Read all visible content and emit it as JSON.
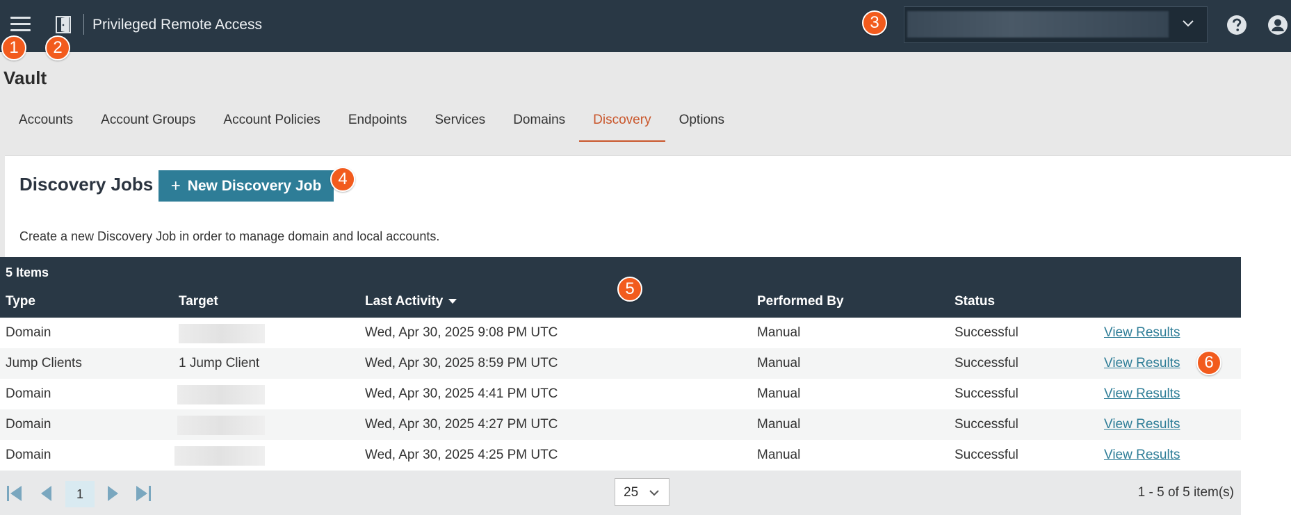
{
  "topbar": {
    "app_title": "Privileged Remote Access"
  },
  "callouts": [
    "1",
    "2",
    "3",
    "4",
    "5",
    "6"
  ],
  "page": {
    "title": "Vault"
  },
  "tabs": [
    {
      "label": "Accounts",
      "active": false
    },
    {
      "label": "Account Groups",
      "active": false
    },
    {
      "label": "Account Policies",
      "active": false
    },
    {
      "label": "Endpoints",
      "active": false
    },
    {
      "label": "Services",
      "active": false
    },
    {
      "label": "Domains",
      "active": false
    },
    {
      "label": "Discovery",
      "active": true
    },
    {
      "label": "Options",
      "active": false
    }
  ],
  "panel": {
    "title": "Discovery Jobs",
    "new_job_plus": "+",
    "new_job_label": "New Discovery Job",
    "description": "Create a new Discovery Job in order to manage domain and local accounts."
  },
  "table": {
    "item_count": "5 Items",
    "columns": {
      "type": "Type",
      "target": "Target",
      "last_activity": "Last Activity",
      "performed_by": "Performed By",
      "status": "Status"
    },
    "rows": [
      {
        "type": "Domain",
        "target": "",
        "last_activity": "Wed, Apr 30, 2025 9:08 PM UTC",
        "performed_by": "Manual",
        "status": "Successful",
        "action": "View Results"
      },
      {
        "type": "Jump Clients",
        "target": "1 Jump Client",
        "last_activity": "Wed, Apr 30, 2025 8:59 PM UTC",
        "performed_by": "Manual",
        "status": "Successful",
        "action": "View Results"
      },
      {
        "type": "Domain",
        "target": "",
        "last_activity": "Wed, Apr 30, 2025 4:41 PM UTC",
        "performed_by": "Manual",
        "status": "Successful",
        "action": "View Results"
      },
      {
        "type": "Domain",
        "target": "",
        "last_activity": "Wed, Apr 30, 2025 4:27 PM UTC",
        "performed_by": "Manual",
        "status": "Successful",
        "action": "View Results"
      },
      {
        "type": "Domain",
        "target": "",
        "last_activity": "Wed, Apr 30, 2025 4:25 PM UTC",
        "performed_by": "Manual",
        "status": "Successful",
        "action": "View Results"
      }
    ]
  },
  "pager": {
    "current_page": "1",
    "page_size": "25",
    "range_text": "1 - 5 of 5 item(s)"
  },
  "colors": {
    "topbar": "#293845",
    "accent_button": "#2e7d97",
    "active_tab": "#c9562b",
    "callout": "#f25b1d"
  }
}
